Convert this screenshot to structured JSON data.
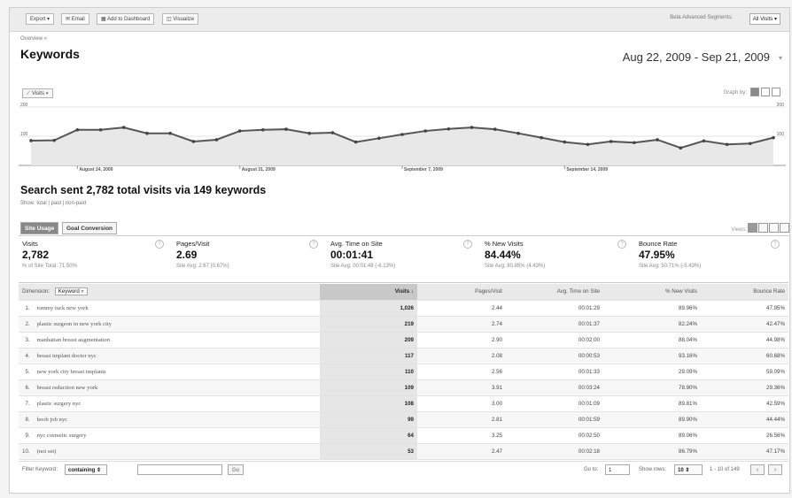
{
  "toolbar": {
    "export": "Export",
    "email": "Email",
    "add_dashboard": "Add to Dashboard",
    "visualize": "Visualize",
    "segments_label": "Beta Advanced Segments:",
    "segments_value": "All Visits"
  },
  "breadcrumb": "Overview »",
  "page_title": "Keywords",
  "date_range": "Aug 22, 2009 - Sep 21, 2009",
  "graph": {
    "metric_button": "Visits",
    "graph_by_label": "Graph by:"
  },
  "chart_data": {
    "type": "area",
    "series": [
      {
        "name": "Visits",
        "values": [
          85,
          86,
          122,
          122,
          130,
          110,
          110,
          82,
          88,
          118,
          122,
          124,
          110,
          112,
          80,
          93,
          106,
          118,
          125,
          130,
          124,
          110,
          95,
          80,
          72,
          82,
          78,
          88,
          60,
          84,
          72,
          75,
          95
        ]
      }
    ],
    "ylim": [
      0,
      200
    ],
    "ytick_labels": [
      "200",
      "100"
    ],
    "xtick_labels": [
      "August 24, 2009",
      "August 31, 2009",
      "September 7, 2009",
      "September 14, 2009"
    ],
    "grid": true
  },
  "headline": "Search sent 2,782 total visits via 149 keywords",
  "show": {
    "label": "Show:",
    "options": "total | paid | non-paid"
  },
  "tabs": [
    "Site Usage",
    "Goal Conversion"
  ],
  "views_label": "Views:",
  "scorecards": [
    {
      "label": "Visits",
      "value": "2,782",
      "sub": "% of Site Total: 71.50%"
    },
    {
      "label": "Pages/Visit",
      "value": "2.69",
      "sub": "Site Avg: 2.67 (0.67%)"
    },
    {
      "label": "Avg. Time on Site",
      "value": "00:01:41",
      "sub": "Site Avg: 00:01:48 (-6.13%)"
    },
    {
      "label": "% New Visits",
      "value": "84.44%",
      "sub": "Site Avg: 80.85% (4.43%)"
    },
    {
      "label": "Bounce Rate",
      "value": "47.95%",
      "sub": "Site Avg: 50.71% (-5.43%)"
    }
  ],
  "table": {
    "dimension_label": "Dimension:",
    "dimension_value": "Keyword",
    "columns": [
      "Visits ↓",
      "Pages/Visit",
      "Avg. Time on Site",
      "% New Visits",
      "Bounce Rate"
    ],
    "rows": [
      {
        "n": "1.",
        "kw": "tommy tuck new york",
        "visits": "1,026",
        "pv": "2.44",
        "time": "00:01:29",
        "new": "89.96%",
        "bounce": "47.95%"
      },
      {
        "n": "2.",
        "kw": "plastic surgeon in new york city",
        "visits": "219",
        "pv": "2.74",
        "time": "00:01:37",
        "new": "82.24%",
        "bounce": "42.47%"
      },
      {
        "n": "3.",
        "kw": "manhattan breast augmentation",
        "visits": "209",
        "pv": "2.90",
        "time": "00:02:00",
        "new": "88.04%",
        "bounce": "44.98%"
      },
      {
        "n": "4.",
        "kw": "breast implant doctor nyc",
        "visits": "117",
        "pv": "2.08",
        "time": "00:00:53",
        "new": "93.16%",
        "bounce": "60.68%"
      },
      {
        "n": "5.",
        "kw": "new york city breast implants",
        "visits": "110",
        "pv": "2.56",
        "time": "00:01:33",
        "new": "29.09%",
        "bounce": "59.09%"
      },
      {
        "n": "6.",
        "kw": "breast reduction new york",
        "visits": "109",
        "pv": "3.91",
        "time": "00:03:24",
        "new": "78.90%",
        "bounce": "29.36%"
      },
      {
        "n": "7.",
        "kw": "plastic surgery nyc",
        "visits": "108",
        "pv": "3.00",
        "time": "00:01:09",
        "new": "89.81%",
        "bounce": "42.59%"
      },
      {
        "n": "8.",
        "kw": "boob job nyc",
        "visits": "99",
        "pv": "2.81",
        "time": "00:01:59",
        "new": "89.90%",
        "bounce": "44.44%"
      },
      {
        "n": "9.",
        "kw": "nyc cosmetic surgery",
        "visits": "64",
        "pv": "3.25",
        "time": "00:02:50",
        "new": "89.06%",
        "bounce": "26.56%"
      },
      {
        "n": "10.",
        "kw": "(not set)",
        "visits": "53",
        "pv": "2.47",
        "time": "00:02:18",
        "new": "86.79%",
        "bounce": "47.17%"
      }
    ]
  },
  "footer": {
    "filter_label": "Filter Keyword:",
    "filter_select": "containing",
    "go": "Go",
    "goto_label": "Go to:",
    "goto_value": "1",
    "show_rows_label": "Show rows:",
    "rows_value": "10",
    "range": "1 - 10 of 149"
  }
}
